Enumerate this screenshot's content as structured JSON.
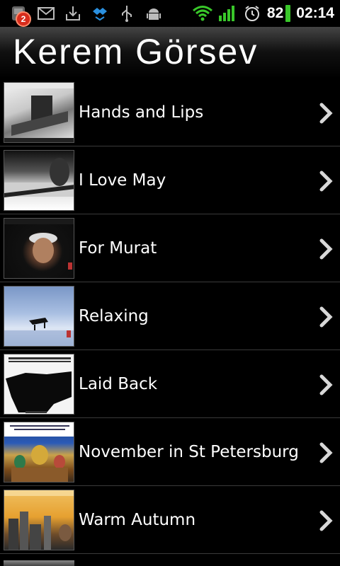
{
  "status_bar": {
    "notification_count": "2",
    "battery_percent": "82",
    "time": "02:14",
    "icons_left": [
      "notification-app-icon",
      "gmail-icon",
      "download-icon",
      "dropbox-icon",
      "usb-icon",
      "android-debug-icon"
    ],
    "icons_right": [
      "wifi-icon",
      "signal-icon",
      "alarm-icon"
    ],
    "accent_green": "#39c72a"
  },
  "header": {
    "title": "Kerem Görsev"
  },
  "albums": [
    {
      "title": "Hands and Lips"
    },
    {
      "title": "I Love May"
    },
    {
      "title": "For Murat"
    },
    {
      "title": "Relaxing"
    },
    {
      "title": "Laid Back"
    },
    {
      "title": "November in St Petersburg"
    },
    {
      "title": "Warm Autumn"
    }
  ]
}
